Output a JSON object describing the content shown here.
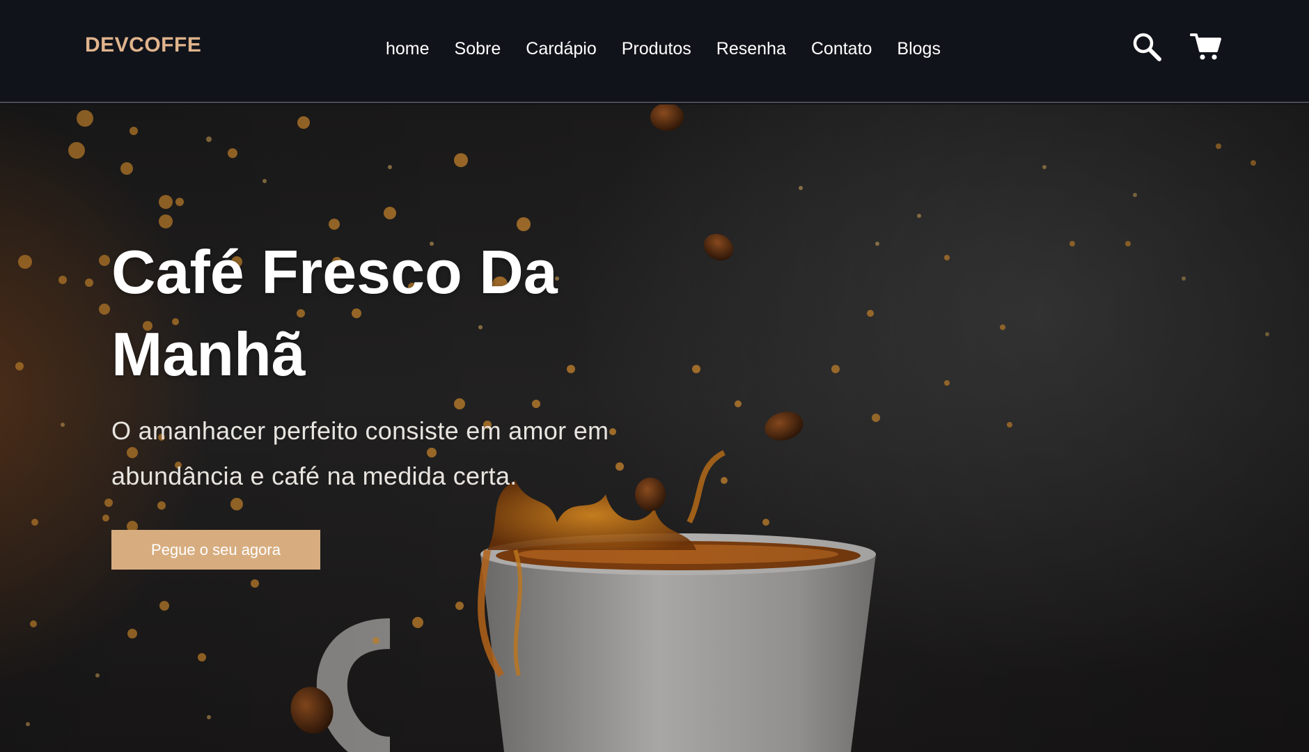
{
  "header": {
    "logo": "DEVCOFFE",
    "nav": [
      "home",
      "Sobre",
      "Cardápio",
      "Produtos",
      "Resenha",
      "Contato",
      "Blogs"
    ],
    "icons": [
      "search-icon",
      "cart-icon"
    ]
  },
  "hero": {
    "title_line1": "Café Fresco Da",
    "title_line2": "Manhã",
    "subtitle_line1": "O amanhacer perfeito consiste em amor em",
    "subtitle_line2": "abundância e café na medida certa.",
    "cta_label": "Pegue o seu agora"
  },
  "colors": {
    "header_bg": "#11131a",
    "logo": "#e0b48d",
    "button": "#d7ad80",
    "text": "#ffffff"
  }
}
